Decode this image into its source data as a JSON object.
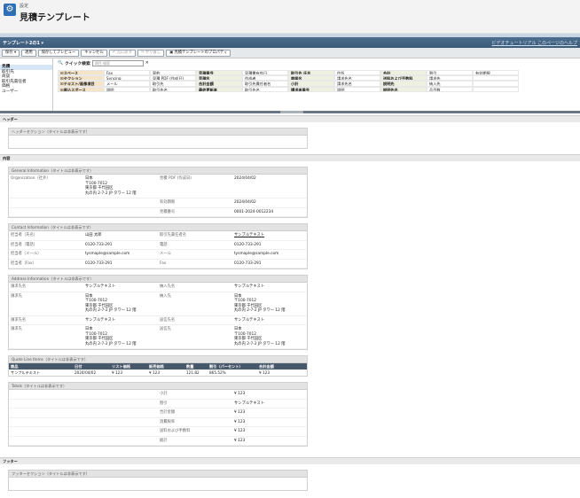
{
  "header": {
    "breadcrumb": "設定",
    "title": "見積テンプレート"
  },
  "toolbar": {
    "template_name": "テンプレート2の1 ▾",
    "links": "ビデオチュートリアル このページのヘルプ"
  },
  "buttons": [
    "保存 ▾",
    "適用",
    "保存してプレビュー",
    "キャンセル",
    "↶ 元に戻す",
    "↷ やり直し",
    "▣ 見積テンプレートのプロパティ"
  ],
  "palette": {
    "left": [
      "見積",
      "取引先",
      "商談",
      "取引先責任者",
      "価格",
      "ユーザー"
    ],
    "quick_label": "クイック検索",
    "quick_placeholder": "項目 検索",
    "rows": [
      [
        "☒スペース",
        "Fax",
        "契約",
        "見積番号",
        "見積書有効日",
        "取引先 氏名",
        "住所",
        "合計",
        "割引",
        "有効期限"
      ],
      [
        "☒セクション",
        "Syncing",
        "見積 PDF (作成日)",
        "見積名",
        "作成者",
        "商談名",
        "請求先名",
        "送料および手数料",
        "請求先",
        ""
      ],
      [
        "☒テキスト/画像項目",
        "メール",
        "取引先",
        "合計金額",
        "取引先責任者名",
        "小計",
        "請求先名",
        "説明先",
        "納入先",
        ""
      ],
      [
        "☒差込スポース",
        "説明",
        "取引先名",
        "最終更新者",
        "取引先名",
        "請求者番号",
        "説明",
        "説明先名",
        "品目数",
        ""
      ]
    ]
  },
  "bands": {
    "header": "ヘッダー",
    "body": "内容",
    "footer": "フッター"
  },
  "header_section": "ヘッダーセクション（タイトルは非表示です）",
  "general": {
    "title": "General Information（タイトルは非表示です）",
    "rows": [
      [
        "Organization（社外）",
        "日本\n〒100-7012\n東京都 千代田区\n丸の内 2-7-2 JP タワー 12 階",
        "見積 PDF (作成日)",
        "2024/04/02"
      ],
      [
        "",
        "",
        "有効期限",
        "2024/04/02"
      ],
      [
        "",
        "",
        "見積番号",
        "0001-2024-0012234"
      ]
    ]
  },
  "contact": {
    "title": "Contact Information（タイトルは非表示です）",
    "rows": [
      [
        "担当者（氏名）",
        "山田 太郎",
        "取引先責任者名",
        "サンプルテキスト"
      ],
      [
        "担当者（電話）",
        "0120-733-291",
        "電話",
        "0120-733-291"
      ],
      [
        "担当者（メール）",
        "tysmaple@sample.com",
        "メール",
        "tysmaple@sample.com"
      ],
      [
        "担当者（Fax）",
        "0120-733-291",
        "Fax",
        "0120-733-291"
      ]
    ]
  },
  "address": {
    "title": "Address Information（タイトルは非表示です）",
    "rows": [
      [
        "請求先名",
        "サンプルテキスト",
        "納入先名",
        "サンプルテキスト"
      ],
      [
        "請求先",
        "日本\n〒100-7012\n東京都 千代田区\n丸の内 2-7-2 JP タワー 12 階",
        "納入先",
        "日本\n〒100-7012\n東京都 千代田区\n丸の内 2-7-2 JP タワー 12 階"
      ],
      [
        "請求先名",
        "サンプルテキスト",
        "送信先名",
        "サンプルテキスト"
      ],
      [
        "請求先",
        "日本\n〒100-7012\n東京都 千代田区\n丸の内 2-7-2 JP タワー 12 階",
        "送信先",
        "日本\n〒100-7012\n東京都 千代田区\n丸の内 2-7-2 JP タワー 12 階"
      ]
    ]
  },
  "quote_lines": {
    "title": "Quote Line Items（タイトルは非表示です）",
    "headers": [
      "商品",
      "日付",
      "リスト価格",
      "販売価格",
      "数量",
      "割引（パーセント）",
      "合計金額"
    ],
    "row": [
      "サンプルテキスト",
      "2024/04/02",
      "¥ 123",
      "¥ 123",
      "121.82",
      "865.52%",
      "¥ 123"
    ]
  },
  "totals": {
    "title": "Totals（タイトルは非表示です）",
    "rows": [
      [
        "小計",
        "¥ 123"
      ],
      [
        "割引",
        "サンプルテキスト"
      ],
      [
        "合計金額",
        "¥ 123"
      ],
      [
        "消費税率",
        "¥ 123"
      ],
      [
        "送料および手数料",
        "¥ 123"
      ],
      [
        "総計",
        "¥ 123"
      ]
    ]
  },
  "footer_section": "フッターセクション（タイトルは非表示です）"
}
